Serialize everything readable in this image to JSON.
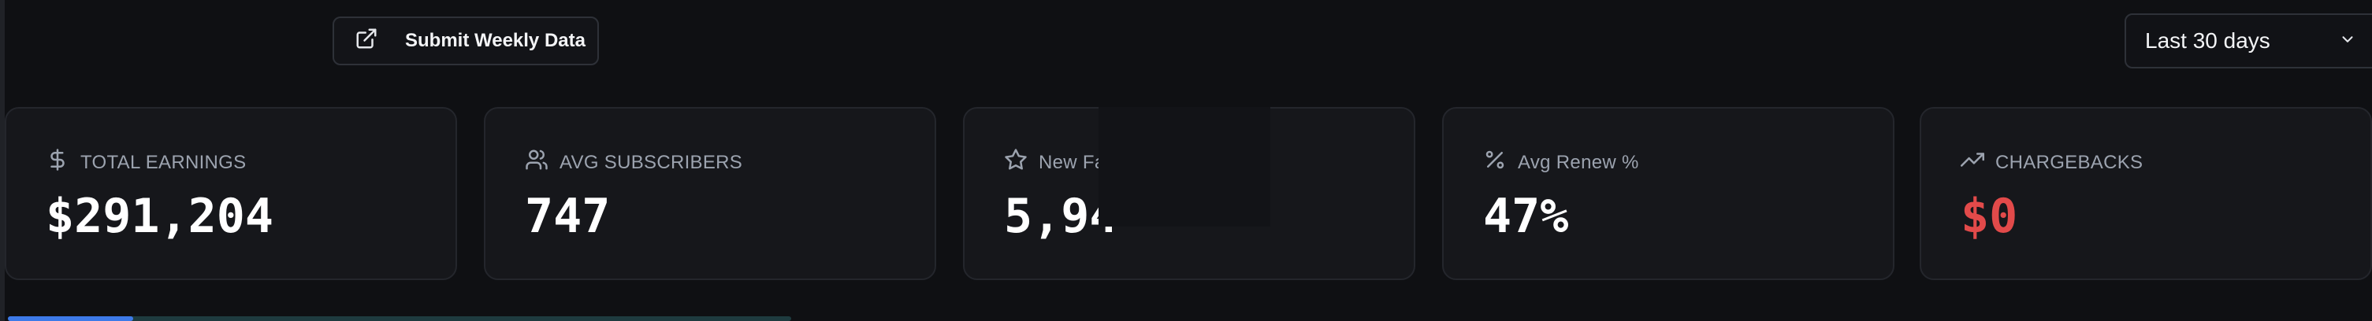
{
  "toolbar": {
    "submit_label": "Submit Weekly Data",
    "submit_icon": "external-link-icon",
    "date_range": {
      "selected": "Last 30 days",
      "icon": "chevron-down-icon"
    }
  },
  "metrics": [
    {
      "id": "total-earnings",
      "label": "TOTAL EARNINGS",
      "value": "$291,204",
      "icon": "dollar-icon"
    },
    {
      "id": "avg-subscribers",
      "label": "AVG SUBSCRIBERS",
      "value": "747",
      "icon": "users-icon"
    },
    {
      "id": "new-fans",
      "label": "New Fa",
      "value": "5,94",
      "icon": "star-icon"
    },
    {
      "id": "avg-renew",
      "label": "Avg Renew %",
      "value": "47%",
      "icon": "percent-icon"
    },
    {
      "id": "chargebacks",
      "label": "CHARGEBACKS",
      "value": "$0",
      "icon": "trending-up-icon"
    }
  ],
  "colors": {
    "background": "#0f1013",
    "card": "#16171b",
    "negative": "#e24a4a",
    "progress": "#3d7ae8"
  },
  "progress": {
    "fraction": 0.16
  }
}
